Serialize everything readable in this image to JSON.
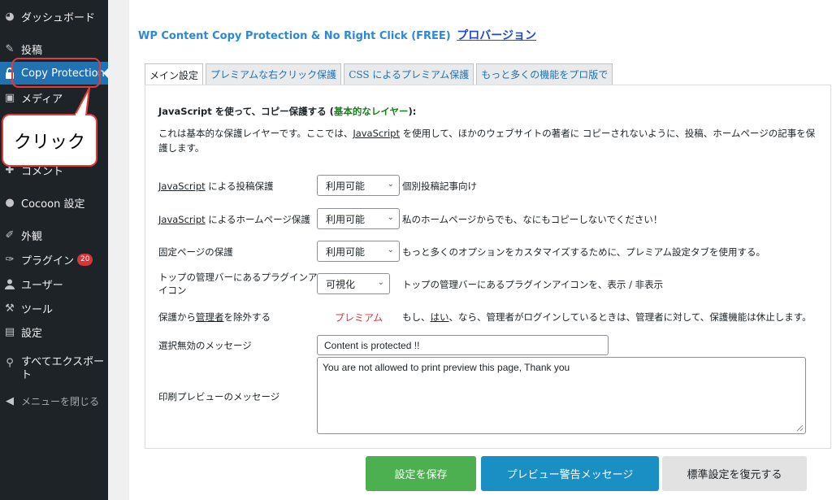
{
  "sidebar": {
    "items": [
      {
        "icon": "dashboard-icon",
        "label": "ダッシュボード"
      },
      {
        "icon": "pin-icon",
        "label": "投稿"
      },
      {
        "icon": "lock-icon",
        "label": "Copy Protection"
      },
      {
        "icon": "media-icon",
        "label": "メディア"
      },
      {
        "icon": "comment-icon",
        "label": "コメント"
      },
      {
        "icon": "cocoon-icon",
        "label": "Cocoon 設定"
      },
      {
        "icon": "brush-icon",
        "label": "外観"
      },
      {
        "icon": "plugin-icon",
        "label": "プラグイン",
        "badge": "20"
      },
      {
        "icon": "user-icon",
        "label": "ユーザー"
      },
      {
        "icon": "wrench-icon",
        "label": "ツール"
      },
      {
        "icon": "settings-icon",
        "label": "設定"
      },
      {
        "icon": "export-icon",
        "label": "すべてエクスポート"
      },
      {
        "icon": "collapse-icon",
        "label": "メニューを閉じる"
      }
    ]
  },
  "annotation": {
    "label": "クリック",
    "color": "#e23b3b"
  },
  "header": {
    "title": "WP Content Copy Protection & No Right Click (FREE)",
    "pro_link": "プロバージョン"
  },
  "tabs": [
    {
      "label": "メイン設定",
      "active": true
    },
    {
      "label": "プレミアムな右クリック保護",
      "active": false
    },
    {
      "label": "CSS によるプレミアム保護",
      "active": false
    },
    {
      "label": "もっと多くの機能をプロ版で",
      "active": false
    }
  ],
  "main": {
    "heading_pre": "JavaScript を使って、コピー保護する (",
    "heading_green": "基本的なレイヤー",
    "heading_post": "):",
    "desc_pre": "これは基本的な保護レイヤーです。ここでは、",
    "desc_link": "JavaScript",
    "desc_post": " を使用して、ほかのウェブサイトの著者に コピーされないように、投稿、ホームページの記事を保護します。",
    "rows": [
      {
        "label_link": "JavaScript",
        "label_rest": " による投稿保護",
        "select": "利用可能",
        "desc": "個別投稿記事向け"
      },
      {
        "label_link": "JavaScript",
        "label_rest": " によるホームページ保護",
        "select": "利用可能",
        "desc": "私のホームページからでも、なにもコピーしないでください！"
      },
      {
        "label": "固定ページの保護",
        "select": "利用可能",
        "desc": "もっと多くのオプションをカスタマイズするために、プレミアム設定タブを使用する。"
      },
      {
        "label": "トップの管理バーにあるプラグインアイコン",
        "select": "可視化",
        "desc": "トップの管理バーにあるプラグインアイコンを、表示 / 非表示"
      }
    ],
    "exclude_label_pre": "保護から",
    "exclude_label_link": "管理者",
    "exclude_label_post": "を除外する",
    "premium": "プレミアム",
    "exclude_desc_pre": "もし、",
    "exclude_desc_link": "はい",
    "exclude_desc_post": "、なら、管理者がログインしているときは、管理者に対して、保護機能は休止します。",
    "selection_label": "選択無効のメッセージ",
    "selection_value": "Content is protected !!",
    "print_label": "印刷プレビューのメッセージ",
    "print_value": "You are not allowed to print preview this page, Thank you"
  },
  "buttons": {
    "save": "設定を保存",
    "preview": "プレビュー警告メッセージ",
    "reset": "標準設定を復元する"
  },
  "colors": {
    "active_menu": "#2271b1",
    "save_button": "#4caf50",
    "preview_button": "#1a8fc3",
    "premium": "#d63638"
  }
}
